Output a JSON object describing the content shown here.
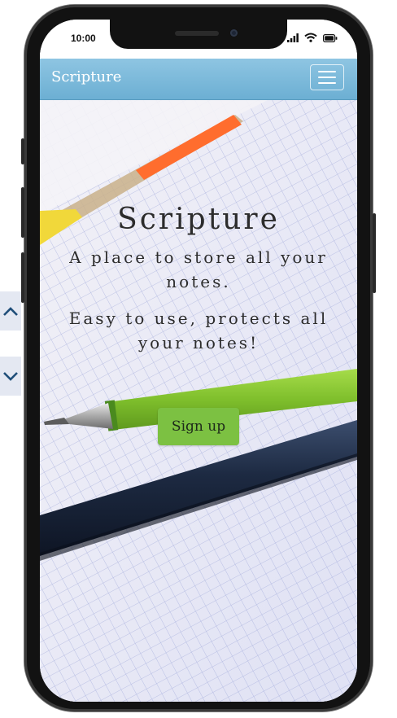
{
  "status_bar": {
    "time": "10:00"
  },
  "navbar": {
    "brand": "Scripture"
  },
  "hero": {
    "title": "Scripture",
    "subtitle": "A place to store all your notes.",
    "tagline": "Easy to use, protects all your notes!",
    "signup_label": "Sign up"
  },
  "colors": {
    "navbar": "#7ab9db",
    "signup_button": "#7cc142",
    "text": "#2c2c2c",
    "scroll_arrow": "#1f4e79"
  },
  "icons": {
    "menu": "hamburger-icon",
    "scroll_up": "chevron-up-icon",
    "scroll_down": "chevron-down-icon",
    "signal": "signal-icon",
    "wifi": "wifi-icon",
    "battery": "battery-icon"
  }
}
